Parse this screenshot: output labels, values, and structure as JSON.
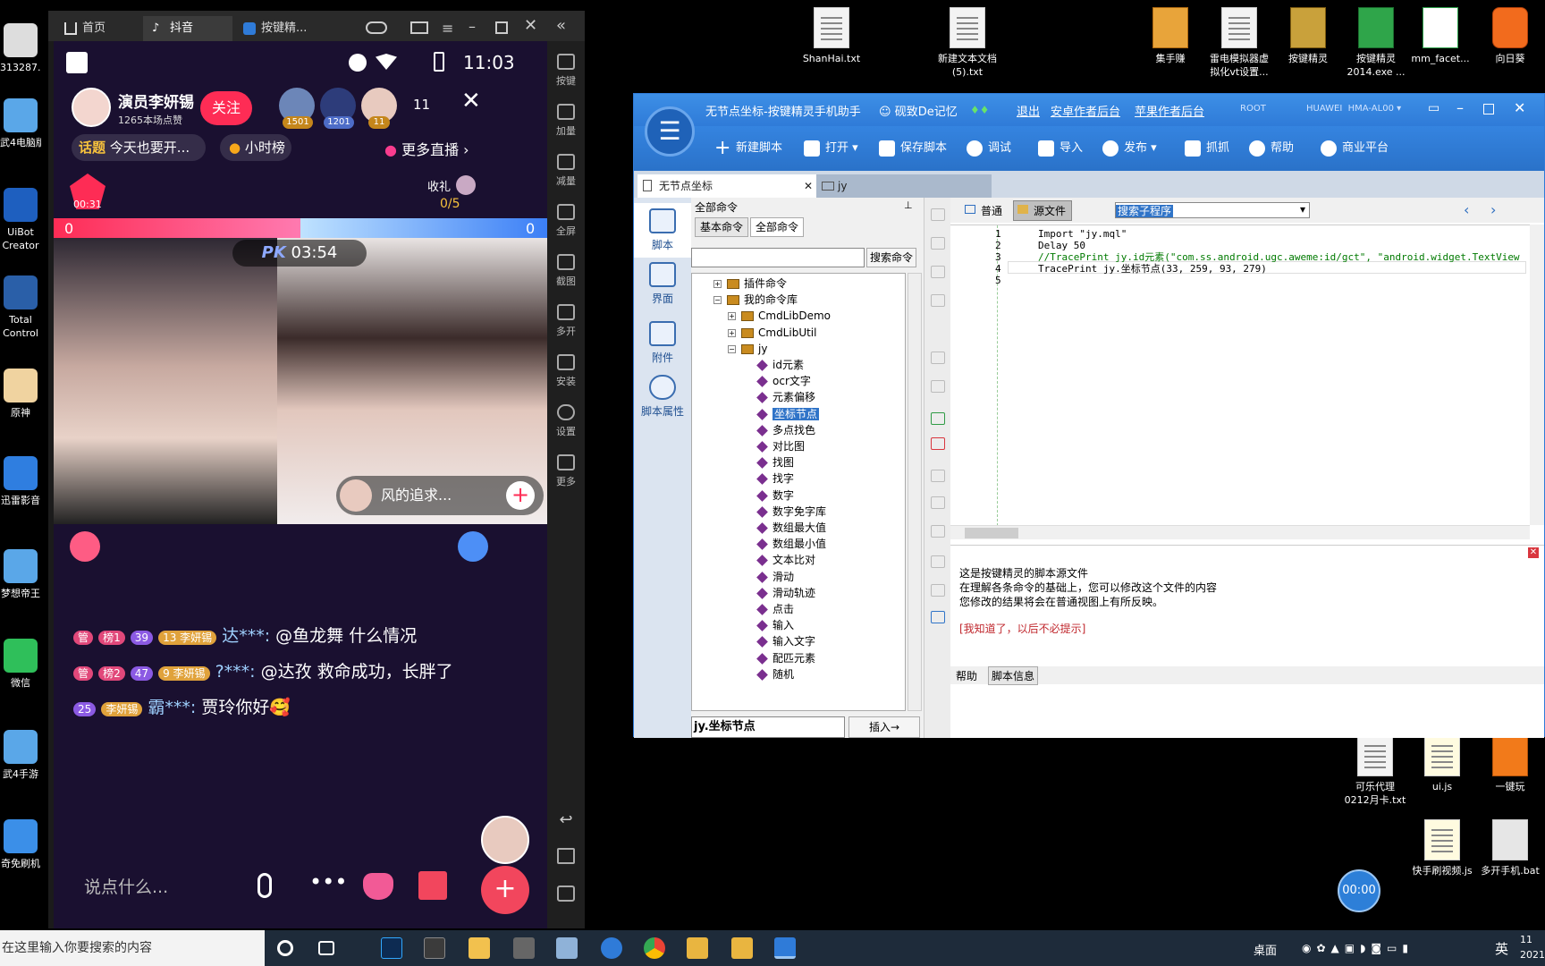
{
  "desktop": {
    "right_icons": [
      {
        "label": "ShanHai.txt",
        "icon": "text-file-icon"
      },
      {
        "label": "新建文本文档\n(5).txt",
        "icon": "text-file-icon"
      },
      {
        "label": "集手赚",
        "icon": "app-icon"
      },
      {
        "label": "雷电模拟器虚\n拟化vt设置...",
        "icon": "text-file-icon"
      },
      {
        "label": "按键精灵",
        "icon": "app-icon"
      },
      {
        "label": "按键精灵\n2014.exe ...",
        "icon": "app-icon"
      },
      {
        "label": "mm_facet...",
        "icon": "qr-image-icon"
      },
      {
        "label": "向日葵",
        "icon": "sunflower-icon"
      }
    ],
    "left_icons": [
      {
        "label": "313287..."
      },
      {
        "label": "武4电脑版"
      },
      {
        "label": "UiBot\nCreator"
      },
      {
        "label": "Total\nControl"
      },
      {
        "label": "原神"
      },
      {
        "label": "迅雷影音"
      },
      {
        "label": "梦想帝王"
      },
      {
        "label": "微信"
      },
      {
        "label": "武4手游"
      },
      {
        "label": "奇免刷机"
      }
    ],
    "lower_icons": [
      {
        "label": "可乐代理\n0212月卡.txt"
      },
      {
        "label": "ui.js"
      },
      {
        "label": "一键玩"
      },
      {
        "label": "快手刷视频.js"
      },
      {
        "label": "多开手机.bat"
      }
    ],
    "timer_bubble": "00:00"
  },
  "emulator": {
    "tabs": [
      {
        "label": "首页",
        "icon": "home-icon"
      },
      {
        "label": "抖音",
        "icon": "tiktok-icon"
      },
      {
        "label": "按键精...",
        "icon": "app-icon"
      }
    ],
    "side_buttons": [
      "按键",
      "加量",
      "减量",
      "全屏",
      "截图",
      "多开",
      "安装",
      "设置",
      "更多"
    ],
    "phone": {
      "time": "11:03",
      "host_name": "演员李妍锡",
      "host_likes": "1265本场点赞",
      "follow": "关注",
      "viewer_badges": [
        "1501",
        "1201",
        "11"
      ],
      "viewer_count": "11",
      "topic_tag": "话题",
      "topic_text": "今天也要开...",
      "hour_rank": "小时榜",
      "more_live": "更多直播",
      "gift_label": "收礼",
      "gift_count": "0/5",
      "pk_timer_small": "00:31",
      "pk_left_score": "0",
      "pk_right_score": "0",
      "pk_label": "PK",
      "pk_time": "03:54",
      "guest_name": "风的追求...",
      "comments": [
        {
          "badges": [
            "管",
            "榜1",
            "39",
            "13 李妍锡"
          ],
          "user": "达***:",
          "text": "@鱼龙舞 什么情况"
        },
        {
          "badges": [
            "管",
            "榜2",
            "47",
            "9 李妍锡"
          ],
          "user": "?***:",
          "text": "@达孜 救命成功，长胖了"
        },
        {
          "badges": [
            "25",
            "李妍锡"
          ],
          "user": "霸***:",
          "text": "贾玲你好🥰"
        }
      ],
      "input_placeholder": "说点什么..."
    }
  },
  "window": {
    "title": "无节点坐标-按键精灵手机助手",
    "user": "砚致De记忆",
    "links": [
      "退出",
      "安卓作者后台",
      "苹果作者后台"
    ],
    "root_label": "ROOT",
    "device": "HUAWEI  HMA-AL00",
    "toolbar": [
      "新建脚本",
      "打开",
      "保存脚本",
      "调试",
      "导入",
      "发布",
      "抓抓",
      "帮助",
      "商业平台"
    ],
    "doc_tabs": [
      "无节点坐标",
      "jy"
    ],
    "left_nav": [
      "脚本",
      "界面",
      "附件",
      "脚本属性"
    ],
    "cmd_panel": {
      "header": "全部命令",
      "tabs": [
        "基本命令",
        "全部命令"
      ],
      "search_btn": "搜索命令",
      "tree": [
        {
          "label": "插件命令",
          "level": 1,
          "type": "folder"
        },
        {
          "label": "我的命令库",
          "level": 1,
          "type": "folder"
        },
        {
          "label": "CmdLibDemo",
          "level": 2,
          "type": "pkg"
        },
        {
          "label": "CmdLibUtil",
          "level": 2,
          "type": "pkg"
        },
        {
          "label": "jy",
          "level": 2,
          "type": "pkg"
        },
        {
          "label": "id元素",
          "level": 3,
          "type": "cmd"
        },
        {
          "label": "ocr文字",
          "level": 3,
          "type": "cmd"
        },
        {
          "label": "元素偏移",
          "level": 3,
          "type": "cmd"
        },
        {
          "label": "坐标节点",
          "level": 3,
          "type": "cmd",
          "selected": true
        },
        {
          "label": "多点找色",
          "level": 3,
          "type": "cmd"
        },
        {
          "label": "对比图",
          "level": 3,
          "type": "cmd"
        },
        {
          "label": "找图",
          "level": 3,
          "type": "cmd"
        },
        {
          "label": "找字",
          "level": 3,
          "type": "cmd"
        },
        {
          "label": "数字",
          "level": 3,
          "type": "cmd"
        },
        {
          "label": "数字免字库",
          "level": 3,
          "type": "cmd"
        },
        {
          "label": "数组最大值",
          "level": 3,
          "type": "cmd"
        },
        {
          "label": "数组最小值",
          "level": 3,
          "type": "cmd"
        },
        {
          "label": "文本比对",
          "level": 3,
          "type": "cmd"
        },
        {
          "label": "滑动",
          "level": 3,
          "type": "cmd"
        },
        {
          "label": "滑动轨迹",
          "level": 3,
          "type": "cmd"
        },
        {
          "label": "点击",
          "level": 3,
          "type": "cmd"
        },
        {
          "label": "输入",
          "level": 3,
          "type": "cmd"
        },
        {
          "label": "输入文字",
          "level": 3,
          "type": "cmd"
        },
        {
          "label": "配匹元素",
          "level": 3,
          "type": "cmd"
        },
        {
          "label": "随机",
          "level": 3,
          "type": "cmd"
        }
      ],
      "current_cmd": "jy.坐标节点",
      "insert_btn": "插入→"
    },
    "editor": {
      "view_tabs": [
        "普通",
        "源文件"
      ],
      "sub_select": "搜索子程序",
      "lines": [
        "Import \"jy.mql\"",
        "Delay 50",
        "//TracePrint jy.id元素(\"com.ss.android.ugc.aweme:id/gct\", \"android.widget.TextView",
        "TracePrint jy.坐标节点(33, 259, 93, 279)",
        ""
      ],
      "hint_lines": [
        "这是按键精灵的脚本源文件",
        "在理解各条命令的基础上，您可以修改这个文件的内容",
        "您修改的结果将会在普通视图上有所反映。"
      ],
      "hint_link": "[我知道了，以后不必提示]",
      "bottom_tabs": [
        "帮助",
        "脚本信息"
      ]
    }
  },
  "taskbar": {
    "search_placeholder": "在这里输入你要搜索的内容",
    "desktop_label": "桌面",
    "ime": "英",
    "clock_partial": "11\n2021"
  }
}
